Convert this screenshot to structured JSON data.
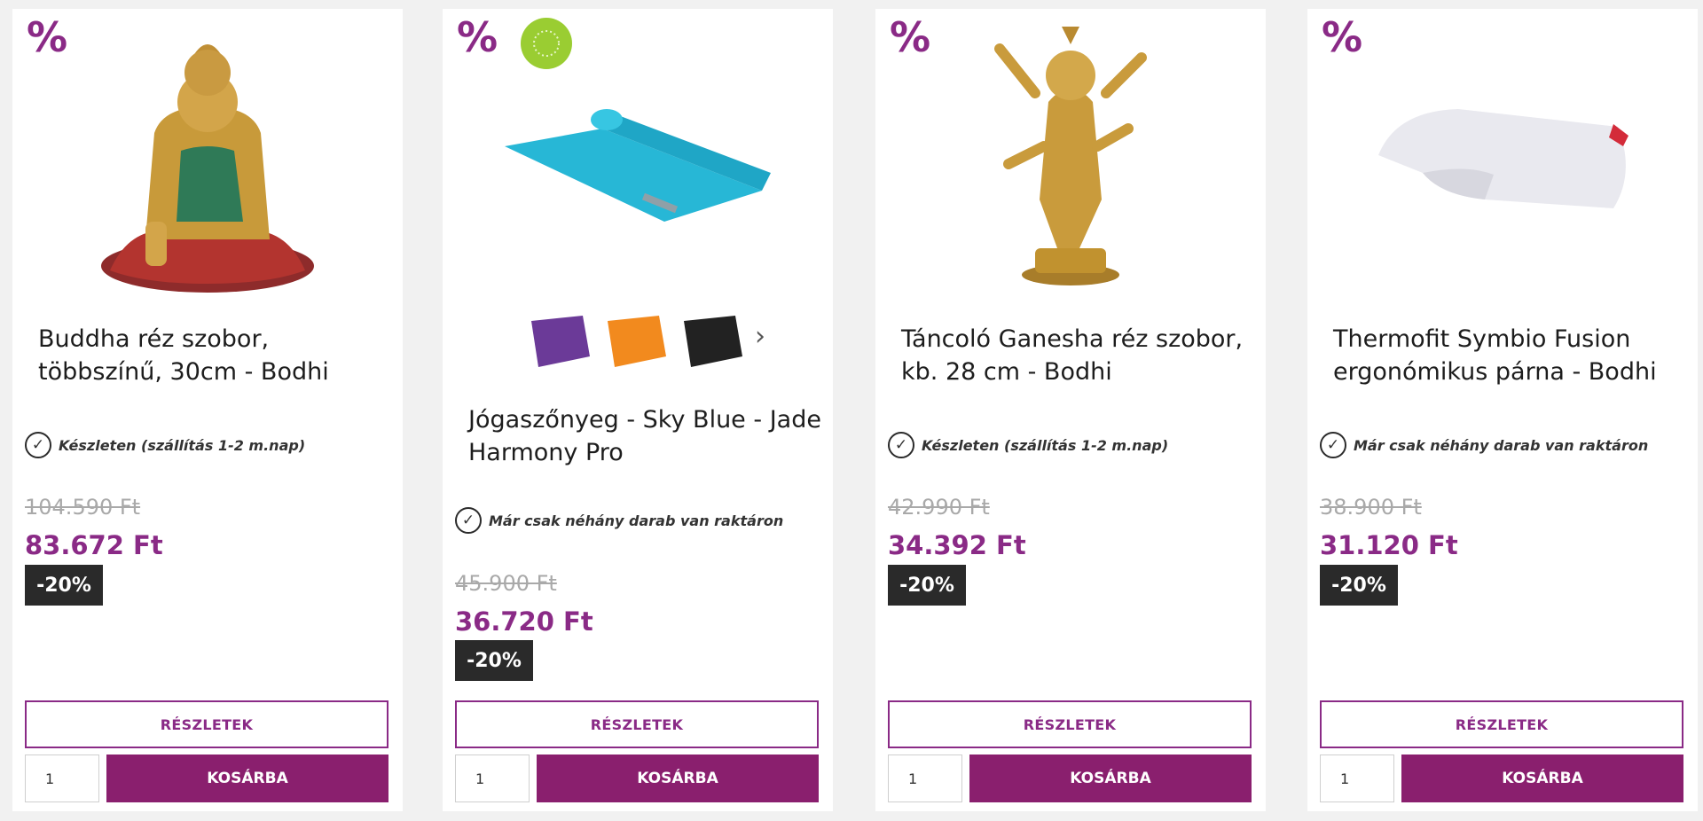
{
  "products": [
    {
      "title": "Buddha réz szobor, többszínű, 30cm - Bodhi",
      "stock": "Készleten (szállítás 1-2 m.nap)",
      "old_price": "104.590 Ft",
      "new_price": "83.672 Ft",
      "discount": "-20%",
      "details_label": "RÉSZLETEK",
      "cart_label": "KOSÁRBA",
      "qty": "1",
      "sale_icon": "%"
    },
    {
      "title": "Jógaszőnyeg - Sky Blue - Jade Harmony Pro",
      "stock": "Már csak néhány darab van raktáron",
      "old_price": "45.900 Ft",
      "new_price": "36.720 Ft",
      "discount": "-20%",
      "details_label": "RÉSZLETEK",
      "cart_label": "KOSÁRBA",
      "qty": "1",
      "sale_icon": "%",
      "variants_next": "›"
    },
    {
      "title": "Táncoló Ganesha réz szobor, kb. 28 cm - Bodhi",
      "stock": "Készleten (szállítás 1-2 m.nap)",
      "old_price": "42.990 Ft",
      "new_price": "34.392 Ft",
      "discount": "-20%",
      "details_label": "RÉSZLETEK",
      "cart_label": "KOSÁRBA",
      "qty": "1",
      "sale_icon": "%"
    },
    {
      "title": "Thermofit Symbio Fusion ergonómikus párna - Bodhi",
      "stock": "Már csak néhány darab van raktáron",
      "old_price": "38.900 Ft",
      "new_price": "31.120 Ft",
      "discount": "-20%",
      "details_label": "RÉSZLETEK",
      "cart_label": "KOSÁRBA",
      "qty": "1",
      "sale_icon": "%"
    }
  ],
  "colors": {
    "accent": "#8a2a86",
    "cart": "#8a1f6e",
    "badge": "#2a2a2a",
    "old_price": "#a9a9a9"
  },
  "icons": {
    "stock": "check-circle-icon",
    "sale": "percent-icon",
    "organic": "eu-organic-leaf-icon"
  }
}
